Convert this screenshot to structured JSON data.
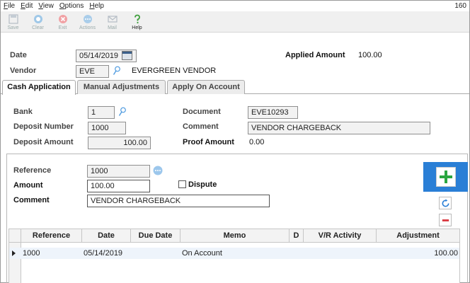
{
  "menu": {
    "items": [
      "File",
      "Edit",
      "View",
      "Options",
      "Help"
    ],
    "right_text": "160"
  },
  "toolbar": {
    "buttons": [
      {
        "label": "Save",
        "icon": "save-icon"
      },
      {
        "label": "Clear",
        "icon": "clear-icon"
      },
      {
        "label": "Exit",
        "icon": "exit-icon"
      },
      {
        "label": "Actions",
        "icon": "actions-icon"
      },
      {
        "label": "Mail",
        "icon": "mail-icon"
      },
      {
        "label": "Help",
        "icon": "help-icon"
      }
    ]
  },
  "header": {
    "date_label": "Date",
    "date_value": "05/14/2019",
    "vendor_label": "Vendor",
    "vendor_code": "EVE",
    "vendor_name": "EVERGREEN VENDOR",
    "applied_amount_label": "Applied Amount",
    "applied_amount_value": "100.00"
  },
  "tabs": [
    {
      "label": "Cash Application",
      "selected": true
    },
    {
      "label": "Manual Adjustments",
      "selected": false
    },
    {
      "label": "Apply On Account",
      "selected": false
    }
  ],
  "cash_app": {
    "bank_label": "Bank",
    "bank_value": "1",
    "deposit_number_label": "Deposit Number",
    "deposit_number_value": "1000",
    "deposit_amount_label": "Deposit Amount",
    "deposit_amount_value": "100.00",
    "document_label": "Document",
    "document_value": "EVE10293",
    "comment_label": "Comment",
    "comment_value": "VENDOR CHARGEBACK",
    "proof_amount_label": "Proof Amount",
    "proof_amount_value": "0.00"
  },
  "detail": {
    "reference_label": "Reference",
    "reference_value": "1000",
    "amount_label": "Amount",
    "amount_value": "100.00",
    "dispute_label": "Dispute",
    "comment_label": "Comment",
    "comment_value": "VENDOR CHARGEBACK"
  },
  "grid": {
    "columns": [
      "Reference",
      "Date",
      "Due Date",
      "Memo",
      "D",
      "V/R Activity",
      "Adjustment"
    ],
    "rows": [
      {
        "reference": "1000",
        "date": "05/14/2019",
        "due_date": "",
        "memo": "On Account",
        "d": "",
        "vr_activity": "",
        "adjustment": "100.00"
      }
    ]
  },
  "colors": {
    "accent": "#2a7fd6",
    "add_green": "#2aa640",
    "remove_red": "#d9363e"
  }
}
